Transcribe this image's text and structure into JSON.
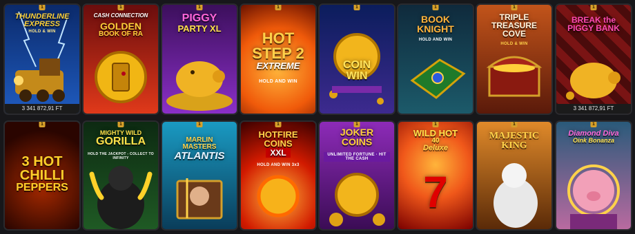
{
  "tiles": [
    {
      "title_lines": [
        "THUNDERLINE",
        "EXPRESS"
      ],
      "subtitle": "HOLD & WIN",
      "jackpot": "3 341 872,91 FT",
      "colors": [
        "#0b2a6b",
        "#1f5bbf"
      ]
    },
    {
      "title_lines": [
        "CASH CONNECTION",
        "GOLDEN",
        "BOOK OF RA"
      ],
      "subtitle": "",
      "jackpot": "",
      "colors": [
        "#6a0d0d",
        "#e0391a"
      ]
    },
    {
      "title_lines": [
        "PIGGY",
        "PARTY XL"
      ],
      "subtitle": "",
      "jackpot": "",
      "colors": [
        "#3c0f5c",
        "#8a2fc7"
      ]
    },
    {
      "title_lines": [
        "HOT",
        "STEP 2",
        "EXTREME"
      ],
      "subtitle": "HOLD AND WIN",
      "jackpot": "",
      "colors": [
        "#6a1200",
        "#f05a0a"
      ]
    },
    {
      "title_lines": [
        "COIN",
        "WIN"
      ],
      "subtitle": "",
      "jackpot": "",
      "colors": [
        "#0b1d5c",
        "#3d2a8f"
      ]
    },
    {
      "title_lines": [
        "BOOK",
        "KNIGHT"
      ],
      "subtitle": "HOLD AND WIN",
      "jackpot": "",
      "colors": [
        "#0f2a3c",
        "#1c5a6a"
      ]
    },
    {
      "title_lines": [
        "TRIPLE",
        "TREASURE",
        "COVE"
      ],
      "subtitle": "HOLD & WIN",
      "jackpot": "",
      "colors": [
        "#5a1a0a",
        "#c2541a"
      ]
    },
    {
      "title_lines": [
        "BREAK the",
        "PIGGY BANK"
      ],
      "subtitle": "",
      "jackpot": "3 341 872,91 FT",
      "colors": [
        "#4a0b0b",
        "#9a1a1a"
      ]
    },
    {
      "title_lines": [
        "3 HOT",
        "CHILLI",
        "PEPPERS"
      ],
      "subtitle": "",
      "jackpot": "",
      "colors": [
        "#2a0500",
        "#8a1800"
      ]
    },
    {
      "title_lines": [
        "MIGHTY WILD",
        "GORILLA"
      ],
      "subtitle": "HOLD THE JACKPOT - COLLECT TO INFINITY",
      "jackpot": "",
      "colors": [
        "#0d2a12",
        "#1f5a24"
      ]
    },
    {
      "title_lines": [
        "MARLIN",
        "MASTERS",
        "ATLANTIS"
      ],
      "subtitle": "",
      "jackpot": "",
      "colors": [
        "#0a3d5a",
        "#1a9ac2"
      ]
    },
    {
      "title_lines": [
        "HOTFIRE",
        "COINS",
        "XXL"
      ],
      "subtitle": "HOLD AND WIN  3x3",
      "jackpot": "",
      "colors": [
        "#3a0000",
        "#d11a00"
      ]
    },
    {
      "title_lines": [
        "JOKER",
        "COINS"
      ],
      "subtitle": "UNLIMITED FORTUNE · HIT THE CASH",
      "jackpot": "",
      "colors": [
        "#3b0c55",
        "#8d2bb8"
      ]
    },
    {
      "title_lines": [
        "WILD HOT",
        "40",
        "Deluxe"
      ],
      "subtitle": "",
      "jackpot": "",
      "colors": [
        "#7a0000",
        "#f0581a"
      ]
    },
    {
      "title_lines": [
        "MAJESTIC",
        "KING"
      ],
      "subtitle": "",
      "jackpot": "",
      "colors": [
        "#5a2a08",
        "#e08a2a"
      ]
    },
    {
      "title_lines": [
        "Diamond Diva",
        "Oink Bonanza"
      ],
      "subtitle": "",
      "jackpot": "",
      "colors": [
        "#2a5a7a",
        "#b96aa0"
      ]
    }
  ],
  "pin_label": "1"
}
